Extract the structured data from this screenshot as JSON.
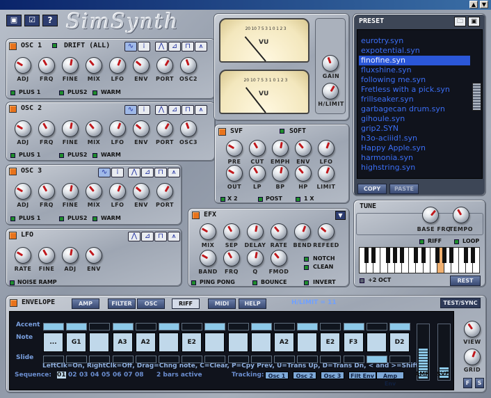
{
  "window": {
    "minimize": "▲",
    "close": "▼"
  },
  "toolbar": {
    "save_icon": "disk-icon",
    "check_icon": "check-icon",
    "help_label": "?"
  },
  "logo": "SimSynth",
  "osc1": {
    "title": "OSC 1",
    "drift_label": "DRIFT (ALL)",
    "knobs": [
      "ADJ",
      "FRQ",
      "FINE",
      "MIX",
      "LFO",
      "ENV",
      "PORT",
      "OSC2"
    ],
    "flags": [
      "PLUS 1",
      "PLUS2",
      "WARM"
    ]
  },
  "osc2": {
    "title": "OSC 2",
    "knobs": [
      "ADJ",
      "FRQ",
      "FINE",
      "MIX",
      "LFO",
      "ENV",
      "PORT",
      "OSC3"
    ],
    "flags": [
      "PLUS 1",
      "PLUS2",
      "WARM"
    ]
  },
  "osc3": {
    "title": "OSC 3",
    "knobs": [
      "ADJ",
      "FRQ",
      "FINE",
      "MIX",
      "LFO",
      "ENV",
      "PORT"
    ],
    "flags": [
      "PLUS 1",
      "PLUS2",
      "WARM"
    ]
  },
  "lfo": {
    "title": "LFO",
    "knobs": [
      "RATE",
      "FINE",
      "ADJ",
      "ENV"
    ],
    "flag": "NOISE RAMP"
  },
  "vu": {
    "label1": "VU",
    "label2": "VU",
    "scale": "20 10 7 5 3 1 0 1 2 3",
    "gain": "GAIN",
    "hlimit": "H/LIMIT"
  },
  "svf": {
    "title": "SVF",
    "soft": "SOFT",
    "knobs_row1": [
      "PRE",
      "CUT",
      "EMPH",
      "ENV",
      "LFO"
    ],
    "knobs_row2": [
      "OUT",
      "LP",
      "BP",
      "HP",
      "LIMIT"
    ],
    "flags": [
      "X 2",
      "POST",
      "1 X"
    ]
  },
  "efx": {
    "title": "EFX",
    "knobs_row1": [
      "MIX",
      "SEP",
      "DELAY",
      "RATE",
      "BEND",
      "REFEED"
    ],
    "knobs_row2": [
      "BAND",
      "FRQ",
      "Q",
      "FMOD"
    ],
    "flags": [
      "NOTCH",
      "CLEAN",
      "PING PONG",
      "BOUNCE",
      "INVERT"
    ]
  },
  "preset": {
    "title": "PRESET",
    "items": [
      "eurotry.syn",
      "expotential.syn",
      "finofine.syn",
      "fluxshine.syn",
      "following me.syn",
      "Fretless with a pick.syn",
      "frillseaker.syn",
      "garbagecan drum.syn",
      "gihoule.syn",
      "grip2.SYN",
      "h3o-aciiid!.syn",
      "Happy Apple.syn",
      "harmonia.syn",
      "highstring.syn"
    ],
    "selected": 2,
    "copy": "COPY",
    "paste": "PASTE"
  },
  "tune": {
    "title": "TUNE",
    "knobs": [
      "BASE FRQ",
      "TEMPO"
    ],
    "riff": "RIFF",
    "loop": "LOOP",
    "oct": "+2 OCT",
    "rest": "REST"
  },
  "envelope": {
    "title": "ENVELOPE",
    "tabs": [
      "AMP",
      "FILTER",
      "OSC",
      "RIFF",
      "MIDI",
      "HELP"
    ],
    "active_tab": "RIFF",
    "hlimit_readout": "H/LIMIT = 11",
    "test_sync": "TEST/SYNC",
    "row_labels": [
      "Accent",
      "Note",
      "Slide"
    ],
    "notes": [
      "...",
      "G1",
      "",
      "A3",
      "A2",
      "",
      "E2",
      "",
      "",
      "",
      "A2",
      "",
      "E2",
      "F3",
      "",
      "D2"
    ],
    "accent": [
      1,
      1,
      0,
      1,
      0,
      1,
      0,
      1,
      0,
      1,
      0,
      1,
      0,
      1,
      0,
      1
    ],
    "slide": [
      0,
      0,
      0,
      0,
      0,
      0,
      0,
      0,
      0,
      0,
      0,
      0,
      0,
      0,
      1,
      0
    ],
    "help": "LeftClk=On, RightClk=Off, Drag=Chng note, C=Clear, P=Cpy Prev, U=Trans Up, D=Trans Dn, < and >=Shift",
    "sequence_label": "Sequence:",
    "sequence": [
      "01",
      "02",
      "03",
      "04",
      "05",
      "06",
      "07",
      "08"
    ],
    "bars": "2 bars active",
    "tracking_label": "Tracking:",
    "tracking": [
      "Osc 1",
      "Osc 2",
      "Osc 3",
      "Filt Env",
      "Amp Env"
    ],
    "meters": [
      "AMP",
      "SVF"
    ],
    "amp_level": 0.55,
    "svf_level": 0.2,
    "view": "VIEW",
    "grid": "GRID",
    "f": "F",
    "s": "S"
  }
}
